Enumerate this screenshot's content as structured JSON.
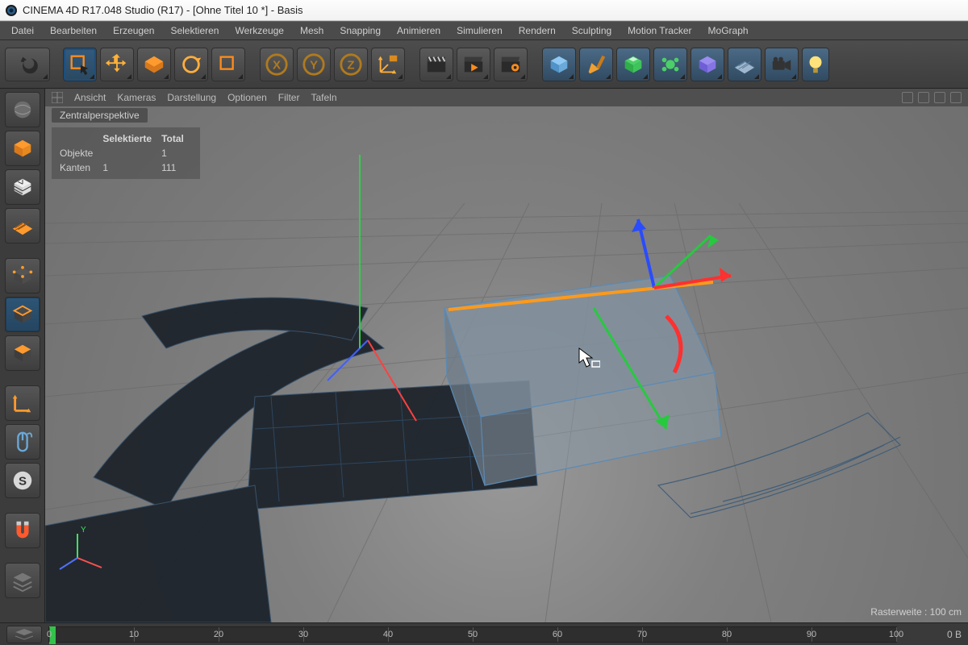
{
  "title": "CINEMA 4D R17.048 Studio (R17) - [Ohne Titel 10 *] - Basis",
  "main_menu": [
    "Datei",
    "Bearbeiten",
    "Erzeugen",
    "Selektieren",
    "Werkzeuge",
    "Mesh",
    "Snapping",
    "Animieren",
    "Simulieren",
    "Rendern",
    "Sculpting",
    "Motion Tracker",
    "MoGraph"
  ],
  "viewport": {
    "menu": [
      "Ansicht",
      "Kameras",
      "Darstellung",
      "Optionen",
      "Filter",
      "Tafeln"
    ],
    "title": "Zentralperspektive",
    "hud": {
      "col_sel": "Selektierte",
      "col_total": "Total",
      "row_obj": "Objekte",
      "row_edge": "Kanten",
      "objects_total": "1",
      "edges_sel": "1",
      "edges_total": "111"
    },
    "grid_label": "Rasterweite : 100 cm"
  },
  "timeline": {
    "ticks": [
      "0",
      "10",
      "20",
      "30",
      "40",
      "50",
      "60",
      "70",
      "80",
      "90",
      "100"
    ],
    "readout": "0 B"
  }
}
